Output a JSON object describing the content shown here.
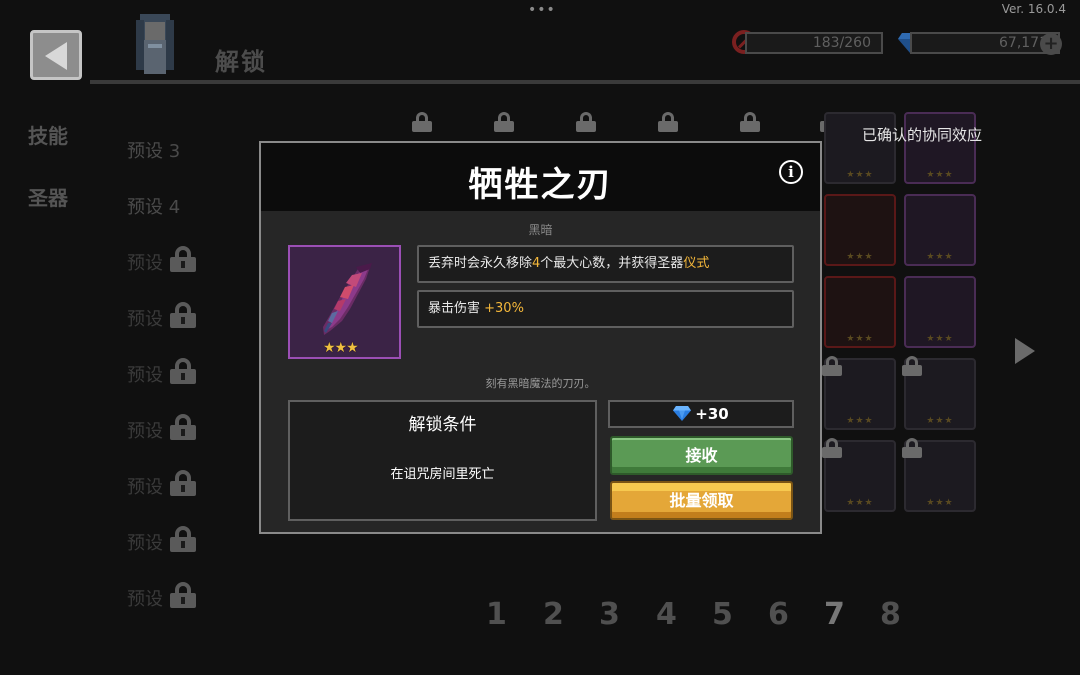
{
  "top": {
    "version": "Ver. 16.0.4",
    "screen_title": "解锁",
    "hearts_resource": "183/260",
    "gems_resource": "67,171"
  },
  "sidebar": {
    "tabs": [
      {
        "label": "技能"
      },
      {
        "label": "圣器"
      }
    ],
    "presets": [
      {
        "label": "预设 3",
        "locked": false
      },
      {
        "label": "预设 4",
        "locked": false
      },
      {
        "label": "预设",
        "locked": true
      },
      {
        "label": "预设",
        "locked": true
      },
      {
        "label": "预设",
        "locked": true
      },
      {
        "label": "预设",
        "locked": true
      },
      {
        "label": "预设",
        "locked": true
      },
      {
        "label": "预设",
        "locked": true
      },
      {
        "label": "预设",
        "locked": true
      }
    ]
  },
  "synergy_label": "已确认的协同效应",
  "pages": [
    "1",
    "2",
    "3",
    "4",
    "5",
    "6",
    "7",
    "8"
  ],
  "modal": {
    "title": "牺牲之刃",
    "category": "黑暗",
    "stars": "★★★",
    "effect1": {
      "prefix": "丢弃时会永久移除",
      "number": "4",
      "middle": "个最大心数，并获得圣器",
      "highlight": "仪式"
    },
    "effect2": {
      "prefix": "暴击伤害 ",
      "highlight": "+30%"
    },
    "flavor": "刻有黑暗魔法的刀刃。",
    "unlock_title": "解锁条件",
    "unlock_condition": "在诅咒房间里死亡",
    "reward": "+30",
    "receive_label": "接收",
    "batch_label": "批量领取"
  },
  "colors": {
    "highlight": "#f4b73a",
    "item_border": "#9b4fb5",
    "receive_button": "#5b9a55",
    "batch_button": "#e4a738"
  },
  "icons": [
    "back-arrow-icon",
    "no-entry-icon",
    "gem-icon",
    "plus-icon",
    "lock-icon",
    "info-icon",
    "right-arrow-icon",
    "dagger-icon"
  ]
}
